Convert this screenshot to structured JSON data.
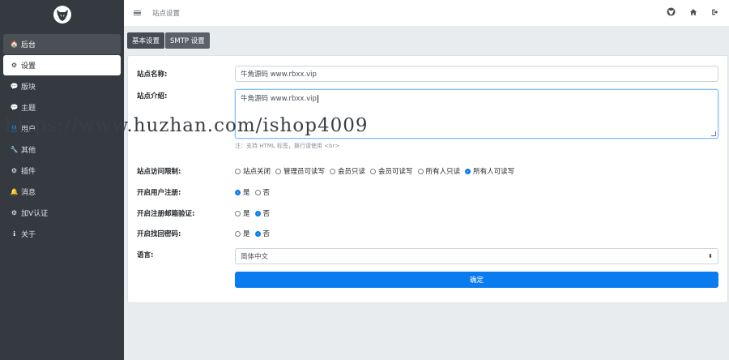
{
  "topbar": {
    "title": "站点设置",
    "icons": [
      "logo-icon",
      "home-icon",
      "logout-icon"
    ]
  },
  "sidebar": {
    "items": [
      {
        "icon": "home-icon",
        "glyph": "🏠",
        "label": "后台"
      },
      {
        "icon": "gear-icon",
        "glyph": "⚙",
        "label": "设置"
      },
      {
        "icon": "comment-icon",
        "glyph": "💬",
        "label": "版块"
      },
      {
        "icon": "comment-icon",
        "glyph": "💬",
        "label": "主题"
      },
      {
        "icon": "user-icon",
        "glyph": "👤",
        "label": "用户"
      },
      {
        "icon": "wrench-icon",
        "glyph": "🔧",
        "label": "其他"
      },
      {
        "icon": "cogs-icon",
        "glyph": "⚙",
        "label": "插件"
      },
      {
        "icon": "bell-icon",
        "glyph": "🔔",
        "label": "消息"
      },
      {
        "icon": "cogs-icon",
        "glyph": "⚙",
        "label": "加V认证"
      },
      {
        "icon": "info-icon",
        "glyph": "ℹ",
        "label": "关于"
      }
    ]
  },
  "tabs": [
    {
      "label": "基本设置"
    },
    {
      "label": "SMTP 设置"
    }
  ],
  "form": {
    "site_name": {
      "label": "站点名称:",
      "value": "牛角源码 www.rbxx.vip"
    },
    "site_intro": {
      "label": "站点介绍:",
      "value": "牛角源码 www.rbxx.vip",
      "hint": "注：支持 HTML 标签，换行请使用 <br>"
    },
    "access_limit": {
      "label": "站点访问限制:",
      "options": [
        "站点关闭",
        "管理员可读写",
        "会员只读",
        "会员可读写",
        "所有人只读",
        "所有人可读写"
      ],
      "selected": "所有人可读写"
    },
    "user_register": {
      "label": "开启用户注册:",
      "options": [
        "是",
        "否"
      ],
      "selected": "是"
    },
    "email_verify": {
      "label": "开启注册邮箱验证:",
      "options": [
        "是",
        "否"
      ],
      "selected": "否"
    },
    "find_password": {
      "label": "开启找回密码:",
      "options": [
        "是",
        "否"
      ],
      "selected": "否"
    },
    "language": {
      "label": "语言:",
      "value": "简体中文"
    },
    "submit": "确定"
  },
  "watermark": "https://www.huzhan.com/ishop4009"
}
